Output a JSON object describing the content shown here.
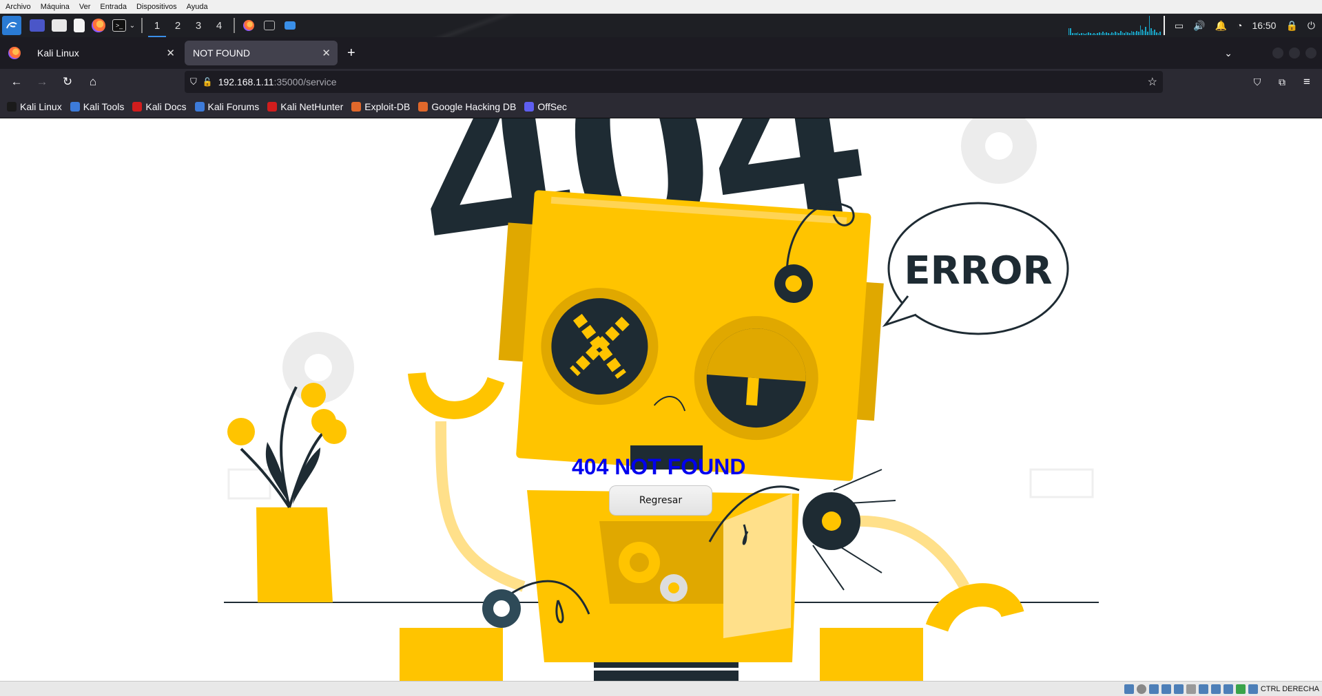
{
  "vbox_menu": [
    "Archivo",
    "Máquina",
    "Ver",
    "Entrada",
    "Dispositivos",
    "Ayuda"
  ],
  "panel": {
    "workspaces": [
      "1",
      "2",
      "3",
      "4"
    ],
    "active_workspace": "1",
    "clock": "16:50"
  },
  "tabs": [
    {
      "label": "Kali Linux",
      "active": false
    },
    {
      "label": "NOT FOUND",
      "active": true
    }
  ],
  "nav": {
    "url_host": "192.168.1.11",
    "url_rest": ":35000/service"
  },
  "bookmarks": [
    {
      "label": "Kali Linux",
      "color": "#1a1a1a"
    },
    {
      "label": "Kali Tools",
      "color": "#3d7bd9"
    },
    {
      "label": "Kali Docs",
      "color": "#d11d1d"
    },
    {
      "label": "Kali Forums",
      "color": "#3d7bd9"
    },
    {
      "label": "Kali NetHunter",
      "color": "#d11d1d"
    },
    {
      "label": "Exploit-DB",
      "color": "#e0682b"
    },
    {
      "label": "Google Hacking DB",
      "color": "#e0682b"
    },
    {
      "label": "OffSec",
      "color": "#5e5ef0"
    }
  ],
  "page": {
    "big_404": "404",
    "error_bubble": "ERROR",
    "heading": "404 NOT FOUND",
    "back_button": "Regresar"
  },
  "statusbar": {
    "host_key": "CTRL DERECHA"
  },
  "colors": {
    "robot_yellow": "#ffc400",
    "robot_dark_yellow": "#e0a800",
    "navy": "#1e2b33",
    "link_blue": "#0000ee"
  }
}
